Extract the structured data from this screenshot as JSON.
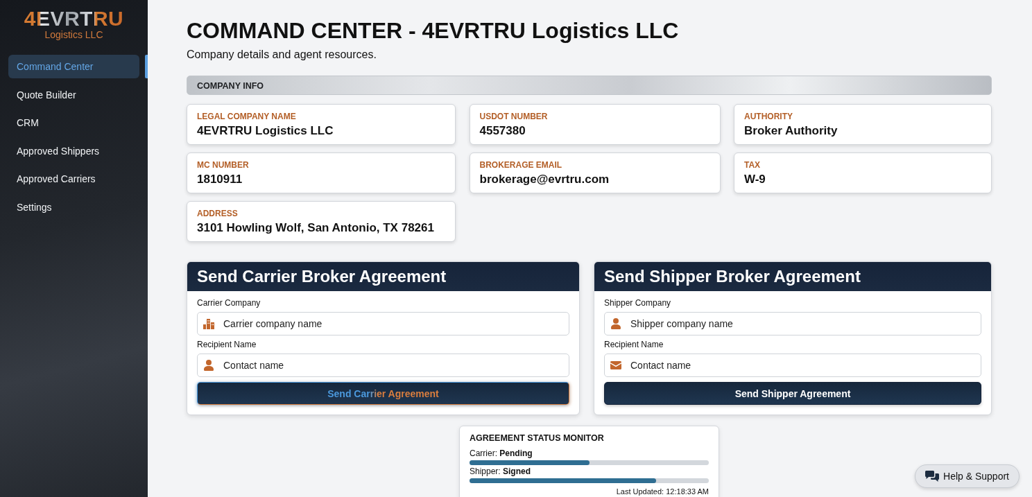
{
  "sidebar": {
    "logo": {
      "mark": "4EVRTRU",
      "subtitle": "Logistics LLC"
    },
    "items": [
      {
        "label": "Command Center",
        "selected": true
      },
      {
        "label": "Quote Builder",
        "selected": false
      },
      {
        "label": "CRM",
        "selected": false
      },
      {
        "label": "Approved Shippers",
        "selected": false
      },
      {
        "label": "Approved Carriers",
        "selected": false
      },
      {
        "label": "Settings",
        "selected": false
      }
    ]
  },
  "header": {
    "title": "COMMAND CENTER - 4EVRTRU Logistics LLC",
    "subtitle": "Company details and agent resources."
  },
  "company_info": {
    "heading": "COMPANY INFO",
    "fields": [
      {
        "label": "LEGAL COMPANY NAME",
        "value": "4EVRTRU Logistics LLC"
      },
      {
        "label": "USDOT NUMBER",
        "value": "4557380"
      },
      {
        "label": "AUTHORITY",
        "value": "Broker Authority"
      },
      {
        "label": "MC NUMBER",
        "value": "1810911"
      },
      {
        "label": "BROKERAGE EMAIL",
        "value": "brokerage@evrtru.com"
      },
      {
        "label": "TAX",
        "value": "W-9"
      },
      {
        "label": "ADDRESS",
        "value": "3101 Howling Wolf, San Antonio, TX 78261"
      }
    ]
  },
  "agreement_forms": [
    {
      "title": "Send Carrier Broker Agreement",
      "fields": [
        {
          "label": "Carrier Company",
          "placeholder": "Carrier company name"
        },
        {
          "label": "Recipient Name",
          "placeholder": "Contact name"
        }
      ],
      "button": {
        "label": "Send Carrier Agreement",
        "focused": true
      }
    },
    {
      "title": "Send Shipper Broker Agreement",
      "fields": [
        {
          "label": "Shipper Company",
          "placeholder": "Shipper company name"
        },
        {
          "label": "Recipient Name",
          "placeholder": "Contact name"
        }
      ],
      "button": {
        "label": "Send Shipper Agreement",
        "focused": false
      }
    }
  ],
  "status_monitor": {
    "title": "AGREEMENT STATUS MONITOR",
    "rows": [
      {
        "text": "Carrier: **Pending**",
        "level": 0.5
      },
      {
        "text": "Shipper: **Signed**",
        "level": 0.78
      }
    ],
    "last_updated": "Last Updated: 12:18:33 AM"
  },
  "help_button": {
    "label": "Help & Support"
  }
}
